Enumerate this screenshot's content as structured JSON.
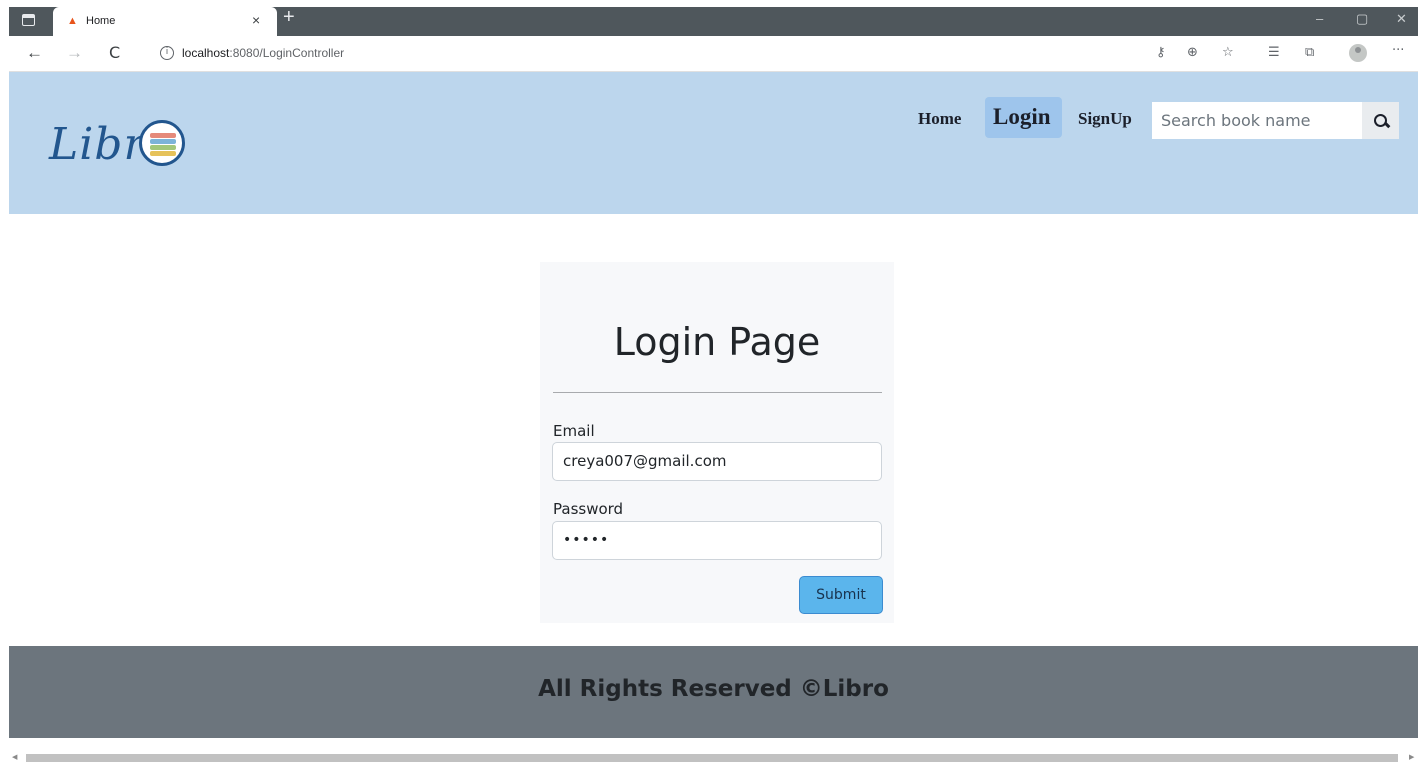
{
  "browser": {
    "tab_title": "Home",
    "tab_close": "×",
    "new_tab": "+",
    "url_host": "localhost",
    "url_path": ":8080/LoginController",
    "window_controls": {
      "minimize": "–",
      "restore": "▢",
      "close": "✕"
    },
    "nav": {
      "back": "←",
      "forward": "→",
      "reload": "C"
    },
    "toolbar_icons": [
      "key-icon",
      "zoom-icon",
      "favorite-icon",
      "favorites-list-icon",
      "collections-icon",
      "profile-icon",
      "more-icon"
    ],
    "more": "···"
  },
  "header": {
    "logo_text": "Libr",
    "nav": {
      "home": "Home",
      "login": "Login",
      "signup": "SignUp"
    },
    "search": {
      "placeholder": "Search book name"
    },
    "colors": {
      "background": "#bcd6ed",
      "active_pill": "#9ec5ec"
    }
  },
  "login": {
    "title": "Login Page",
    "email_label": "Email",
    "email_value": "creya007@gmail.com",
    "password_label": "Password",
    "password_value": "•••••",
    "submit_label": "Submit"
  },
  "footer": {
    "text": "All Rights Reserved ©Libro",
    "color": "#6c757d"
  }
}
